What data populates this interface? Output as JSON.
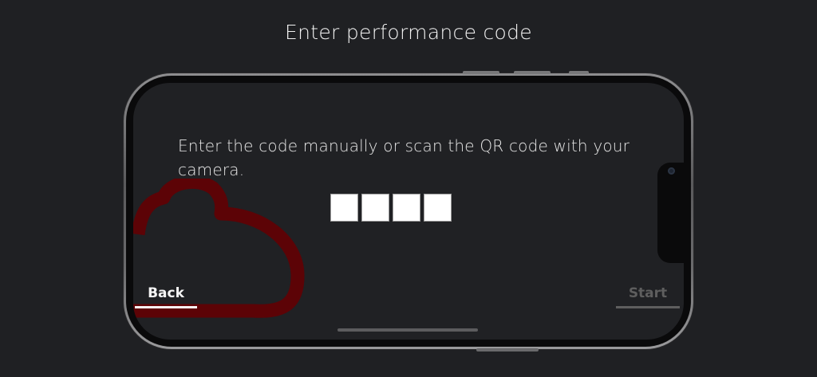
{
  "header": {
    "title": "Enter performance code"
  },
  "screen": {
    "instruction": "Enter the code manually or scan the QR code with your camera.",
    "code_inputs": [
      "",
      "",
      "",
      ""
    ],
    "back_label": "Back",
    "start_label": "Start"
  },
  "colors": {
    "background": "#1f2023",
    "cloud_logo": "#5c0306",
    "start_disabled": "#5e5e5e"
  },
  "icons": {
    "logo": "cloud-logo-icon",
    "camera": "camera-icon"
  }
}
